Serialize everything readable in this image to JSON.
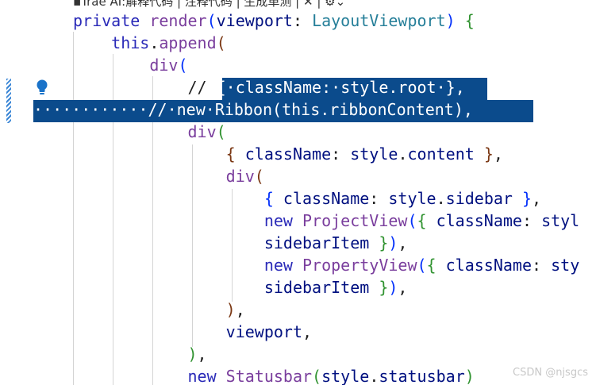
{
  "top_hint": "▪Trae AI:解释代码 | 注释代码 | 生成单测 | ✕ | ⚙⌄",
  "watermark": "CSDN @njsgcs",
  "icons": {
    "lightbulb": "lightbulb-icon"
  },
  "lines": [
    [
      {
        "t": "private",
        "c": "kw2"
      },
      {
        "t": " "
      },
      {
        "t": "render",
        "c": "fn2"
      },
      {
        "t": "(",
        "c": "br1"
      },
      {
        "t": "viewport",
        "c": "pa"
      },
      {
        "t": ": "
      },
      {
        "t": "LayoutViewport",
        "c": "ty"
      },
      {
        "t": ")",
        "c": "br1"
      },
      {
        "t": " "
      },
      {
        "t": "{",
        "c": "br2"
      }
    ],
    [
      {
        "t": "    "
      },
      {
        "t": "this",
        "c": "kw2"
      },
      {
        "t": "."
      },
      {
        "t": "append",
        "c": "fn2"
      },
      {
        "t": "(",
        "c": "br3"
      }
    ],
    [
      {
        "t": "        "
      },
      {
        "t": "div",
        "c": "fn2"
      },
      {
        "t": "(",
        "c": "br1"
      }
    ],
    [
      {
        "t": "            "
      },
      {
        "t": "// ",
        "c": "cm"
      },
      {
        "t": "{",
        "c": "selected"
      },
      {
        "t": "·",
        "c": "selected"
      },
      {
        "t": "className:",
        "c": "selected"
      },
      {
        "t": "·",
        "c": "selected"
      },
      {
        "t": "style.root",
        "c": "selected"
      },
      {
        "t": "·",
        "c": "selected"
      },
      {
        "t": "},",
        "c": "selected"
      }
    ],
    [
      {
        "t": "············",
        "c": "selected"
      },
      {
        "t": "//",
        "c": "selected"
      },
      {
        "t": "·",
        "c": "selected"
      },
      {
        "t": "new",
        "c": "selected"
      },
      {
        "t": "·",
        "c": "selected"
      },
      {
        "t": "Ribbon(this.ribbonContent),",
        "c": "selected"
      }
    ],
    [
      {
        "t": "            "
      },
      {
        "t": "div",
        "c": "fn2"
      },
      {
        "t": "(",
        "c": "br2"
      }
    ],
    [
      {
        "t": "                "
      },
      {
        "t": "{",
        "c": "br3"
      },
      {
        "t": " "
      },
      {
        "t": "className",
        "c": "pa"
      },
      {
        "t": ": "
      },
      {
        "t": "style",
        "c": "pa"
      },
      {
        "t": "."
      },
      {
        "t": "content",
        "c": "pa"
      },
      {
        "t": " "
      },
      {
        "t": "}",
        "c": "br3"
      },
      {
        "t": ","
      }
    ],
    [
      {
        "t": "                "
      },
      {
        "t": "div",
        "c": "fn2"
      },
      {
        "t": "(",
        "c": "br3"
      }
    ],
    [
      {
        "t": "                    "
      },
      {
        "t": "{",
        "c": "br1"
      },
      {
        "t": " "
      },
      {
        "t": "className",
        "c": "pa"
      },
      {
        "t": ": "
      },
      {
        "t": "style",
        "c": "pa"
      },
      {
        "t": "."
      },
      {
        "t": "sidebar",
        "c": "pa"
      },
      {
        "t": " "
      },
      {
        "t": "}",
        "c": "br1"
      },
      {
        "t": ","
      }
    ],
    [
      {
        "t": "                    "
      },
      {
        "t": "new",
        "c": "kw2"
      },
      {
        "t": " "
      },
      {
        "t": "ProjectView",
        "c": "fn2"
      },
      {
        "t": "(",
        "c": "br1"
      },
      {
        "t": "{",
        "c": "br2"
      },
      {
        "t": " "
      },
      {
        "t": "className",
        "c": "pa"
      },
      {
        "t": ": "
      },
      {
        "t": "styl",
        "c": "pa"
      }
    ],
    [
      {
        "t": "                    "
      },
      {
        "t": "sidebarItem",
        "c": "pa"
      },
      {
        "t": " "
      },
      {
        "t": "}",
        "c": "br2"
      },
      {
        "t": ")",
        "c": "br1"
      },
      {
        "t": ","
      }
    ],
    [
      {
        "t": "                    "
      },
      {
        "t": "new",
        "c": "kw2"
      },
      {
        "t": " "
      },
      {
        "t": "PropertyView",
        "c": "fn2"
      },
      {
        "t": "(",
        "c": "br1"
      },
      {
        "t": "{",
        "c": "br2"
      },
      {
        "t": " "
      },
      {
        "t": "className",
        "c": "pa"
      },
      {
        "t": ": "
      },
      {
        "t": "sty",
        "c": "pa"
      }
    ],
    [
      {
        "t": "                    "
      },
      {
        "t": "sidebarItem",
        "c": "pa"
      },
      {
        "t": " "
      },
      {
        "t": "}",
        "c": "br2"
      },
      {
        "t": ")",
        "c": "br1"
      },
      {
        "t": ","
      }
    ],
    [
      {
        "t": "                "
      },
      {
        "t": ")",
        "c": "br3"
      },
      {
        "t": ","
      }
    ],
    [
      {
        "t": "                "
      },
      {
        "t": "viewport",
        "c": "pa"
      },
      {
        "t": ","
      }
    ],
    [
      {
        "t": "            "
      },
      {
        "t": ")",
        "c": "br2"
      },
      {
        "t": ","
      }
    ],
    [
      {
        "t": "            "
      },
      {
        "t": "new",
        "c": "kw2"
      },
      {
        "t": " "
      },
      {
        "t": "Statusbar",
        "c": "fn2"
      },
      {
        "t": "(",
        "c": "br2"
      },
      {
        "t": "style",
        "c": "pa"
      },
      {
        "t": "."
      },
      {
        "t": "statusbar",
        "c": "pa"
      },
      {
        "t": ")",
        "c": "br2"
      }
    ]
  ]
}
